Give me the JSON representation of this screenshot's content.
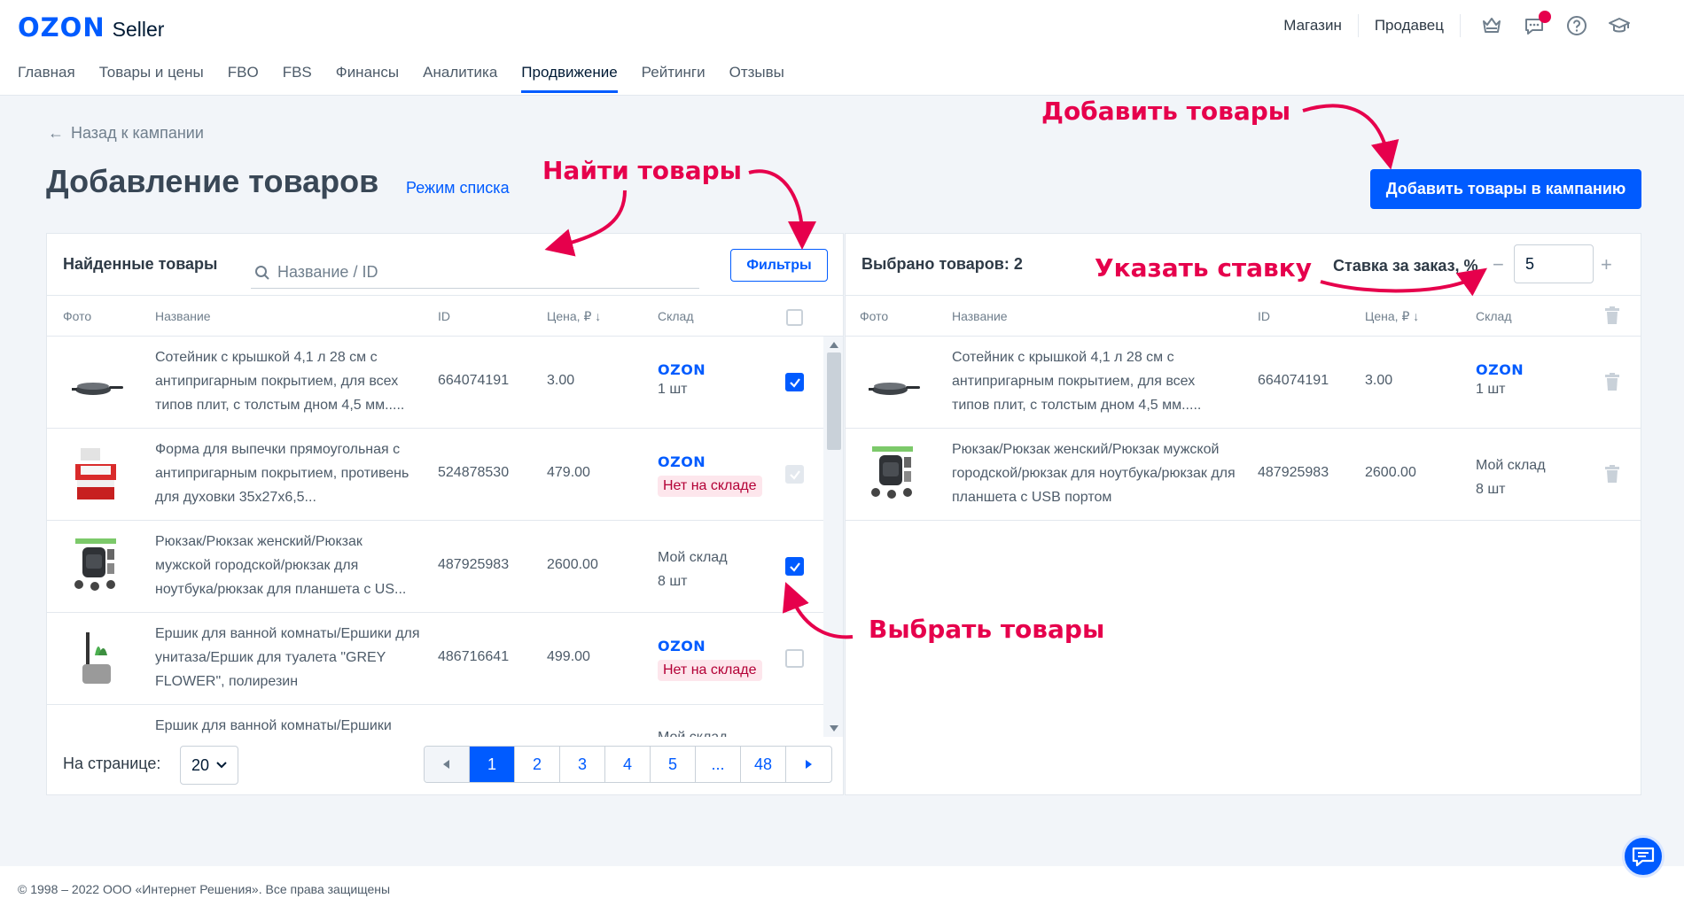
{
  "header": {
    "logo_ozon": "OZON",
    "logo_seller": "Seller",
    "links": [
      "Магазин",
      "Продавец"
    ],
    "icons": [
      "crown-icon",
      "chat-icon",
      "help-icon",
      "graduation-cap-icon"
    ]
  },
  "nav": {
    "items": [
      "Главная",
      "Товары и цены",
      "FBO",
      "FBS",
      "Финансы",
      "Аналитика",
      "Продвижение",
      "Рейтинги",
      "Отзывы"
    ],
    "active": "Продвижение"
  },
  "page": {
    "back_label": "Назад к кампании",
    "title": "Добавление товаров",
    "list_mode": "Режим списка",
    "add_button": "Добавить товары в кампанию"
  },
  "left_panel": {
    "title": "Найденные товары",
    "search_placeholder": "Название / ID",
    "filters_label": "Фильтры",
    "columns": {
      "photo": "Фото",
      "name": "Название",
      "id": "ID",
      "price": "Цена, ₽ ↓",
      "warehouse": "Склад"
    },
    "rows": [
      {
        "name": "Сотейник с крышкой 4,1 л 28 см с антипригарным покрытием, для всех типов плит, с толстым дном 4,5 мм.....",
        "id": "664074191",
        "price": "3.00",
        "warehouse_logo": "OZON",
        "stock": "1 шт",
        "checkbox": "checked"
      },
      {
        "name": "Форма для выпечки прямоугольная с антипригарным покрытием, противень для духовки 35x27x6,5...",
        "id": "524878530",
        "price": "479.00",
        "warehouse_logo": "OZON",
        "stock_status": "Нет на складе",
        "checkbox": "disabled"
      },
      {
        "name": "Рюкзак/Рюкзак женский/Рюкзак мужской городской/рюкзак для ноутбука/рюкзак для планшета с US...",
        "id": "487925983",
        "price": "2600.00",
        "warehouse": "Мой склад",
        "stock": "8 шт",
        "checkbox": "checked"
      },
      {
        "name": "Ершик для ванной комнаты/Ершики для унитаза/Ершик для туалета \"GREY FLOWER\", полирезин",
        "id": "486716641",
        "price": "499.00",
        "warehouse_logo": "OZON",
        "stock_status": "Нет на складе",
        "checkbox": "unchecked"
      },
      {
        "name": "Ершик для ванной комнаты/Ершики",
        "warehouse": "Мой склад"
      }
    ],
    "per_page_label": "На странице:",
    "per_page_value": "20",
    "pages": [
      "1",
      "2",
      "3",
      "4",
      "5",
      "...",
      "48"
    ],
    "active_page": "1"
  },
  "right_panel": {
    "title": "Выбрано товаров: 2",
    "rate_label": "Ставка за заказ, %",
    "rate_value": "5",
    "rate_minus": "−",
    "rate_plus": "+",
    "columns": {
      "photo": "Фото",
      "name": "Название",
      "id": "ID",
      "price": "Цена, ₽ ↓",
      "warehouse": "Склад"
    },
    "rows": [
      {
        "name": "Сотейник с крышкой 4,1 л 28 см с антипригарным покрытием, для всех типов плит, с толстым дном 4,5 мм.....",
        "id": "664074191",
        "price": "3.00",
        "warehouse_logo": "OZON",
        "stock": "1 шт"
      },
      {
        "name": "Рюкзак/Рюкзак женский/Рюкзак мужской городской/рюкзак для ноутбука/рюкзак для планшета с USB портом",
        "id": "487925983",
        "price": "2600.00",
        "warehouse": "Мой склад",
        "stock": "8 шт"
      }
    ]
  },
  "annotations": {
    "add_products": "Добавить товары",
    "find_products": "Найти товары",
    "set_rate": "Указать ставку",
    "select_products": "Выбрать товары",
    "color": "#e6004c"
  },
  "footer": {
    "copyright": "© 1998 – 2022 ООО «Интернет Решения». Все права защищены"
  },
  "colors": {
    "accent": "#005bff",
    "annotation": "#e6004c",
    "page_bg": "#f2f5f9"
  }
}
